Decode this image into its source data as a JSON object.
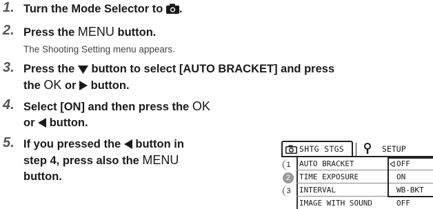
{
  "steps": [
    {
      "num": "1.",
      "text": "Turn the Mode Selector to",
      "after": "."
    },
    {
      "num": "2.",
      "text_before": "Press the",
      "menu": "MENU",
      "text_after": "button.",
      "sub": "The Shooting Setting menu appears."
    },
    {
      "num": "3.",
      "line1_before": "Press the",
      "line1_after": "button to select [AUTO BRACKET] and press",
      "line2_before": "the",
      "ok": "OK",
      "line2_mid": "or",
      "line2_after": "button."
    },
    {
      "num": "4.",
      "line1_before": "Select [ON] and then press the",
      "ok": "OK",
      "line2_before": "or",
      "line2_after": "button."
    },
    {
      "num": "5.",
      "line1_before": "If you pressed the",
      "line1_after": "button in",
      "line2_before": "step 4, press also the",
      "menu": "MENU",
      "line3": "button."
    }
  ],
  "screen": {
    "tab_shooting_label": "SHTG STGS",
    "tab_setup_label": "SETUP",
    "page_numbers": [
      "1",
      "2",
      "3"
    ],
    "rows": [
      {
        "label": "AUTO BRACKET",
        "value": "OFF"
      },
      {
        "label": "TIME EXPOSURE",
        "value": "ON"
      },
      {
        "label": "INTERVAL",
        "value": "WB-BKT"
      },
      {
        "label": "IMAGE WITH SOUND",
        "value": "OFF"
      }
    ]
  },
  "colors": {
    "step_number": "#555555",
    "text": "#1a1a1a",
    "active_page": "#9a9a9a"
  },
  "icons": [
    "camera-icon",
    "down-triangle-icon",
    "right-triangle-icon",
    "left-triangle-icon",
    "wrench-icon"
  ]
}
